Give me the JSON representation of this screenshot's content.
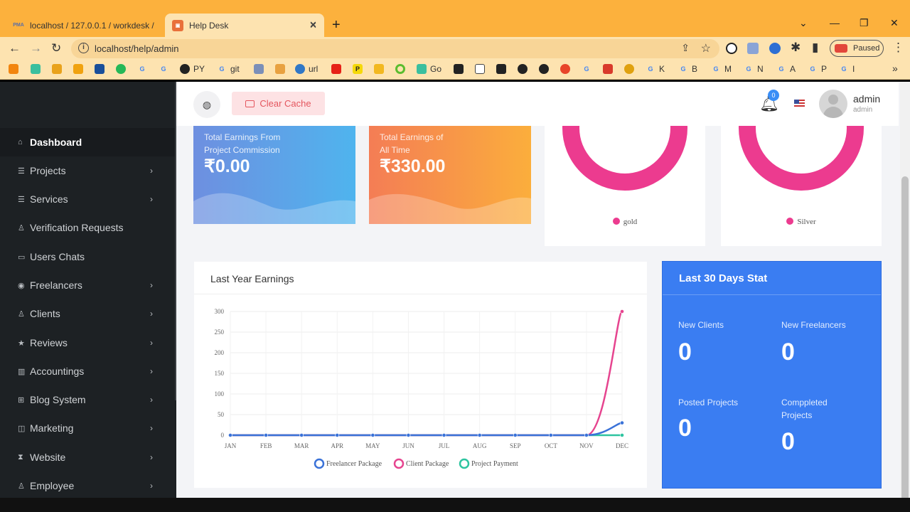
{
  "browser": {
    "tabs": [
      {
        "title": "localhost / 127.0.0.1 / workdesk /",
        "active": false
      },
      {
        "title": "Help Desk",
        "active": true
      }
    ],
    "url": "localhost/help/admin",
    "profile_status": "Paused",
    "bookmarks": [
      "PY",
      "git",
      "url",
      "Go",
      "K",
      "B",
      "M",
      "N",
      "A",
      "P",
      "I"
    ]
  },
  "header": {
    "clear_cache_label": "Clear Cache",
    "notification_count": "0",
    "user_name": "admin",
    "user_role": "admin"
  },
  "sidebar": {
    "items": [
      {
        "label": "Dashboard",
        "active": true
      },
      {
        "label": "Projects",
        "has_submenu": true
      },
      {
        "label": "Services",
        "has_submenu": true
      },
      {
        "label": "Verification Requests",
        "has_submenu": false
      },
      {
        "label": "Users Chats",
        "has_submenu": false
      },
      {
        "label": "Freelancers",
        "has_submenu": true
      },
      {
        "label": "Clients",
        "has_submenu": true
      },
      {
        "label": "Reviews",
        "has_submenu": true
      },
      {
        "label": "Accountings",
        "has_submenu": true
      },
      {
        "label": "Blog System",
        "has_submenu": true
      },
      {
        "label": "Marketing",
        "has_submenu": true
      },
      {
        "label": "Website",
        "has_submenu": true
      },
      {
        "label": "Employee",
        "has_submenu": true
      }
    ]
  },
  "stat_cards": [
    {
      "label_line1": "Total Earnings From",
      "label_line2": "Project Commission",
      "value": "₹0.00",
      "theme": "blue"
    },
    {
      "label_line1": "Total Earnings of",
      "label_line2": "All Time",
      "value": "₹330.00",
      "theme": "orange"
    }
  ],
  "donuts": [
    {
      "legend": "gold",
      "color": "#ec3b8f"
    },
    {
      "legend": "Silver",
      "color": "#ec3b8f"
    }
  ],
  "last30": {
    "title": "Last 30 Days Stat",
    "stats": [
      {
        "label_line1": "New Clients",
        "label_line2": "",
        "value": "0"
      },
      {
        "label_line1": "New Freelancers",
        "label_line2": "",
        "value": "0"
      },
      {
        "label_line1": "Posted Projects",
        "label_line2": "",
        "value": "0"
      },
      {
        "label_line1": "Comppleted",
        "label_line2": "Projects",
        "value": "0"
      }
    ]
  },
  "chart_data": {
    "type": "line",
    "title": "Last Year Earnings",
    "categories": [
      "JAN",
      "FEB",
      "MAR",
      "APR",
      "MAY",
      "JUN",
      "JUL",
      "AUG",
      "SEP",
      "OCT",
      "NOV",
      "DEC"
    ],
    "ylim": [
      0,
      300
    ],
    "yticks": [
      0,
      50,
      100,
      150,
      200,
      250,
      300
    ],
    "grid": true,
    "legend_position": "bottom",
    "series": [
      {
        "name": "Freelancer Package",
        "color": "#3a72d8",
        "values": [
          0,
          0,
          0,
          0,
          0,
          0,
          0,
          0,
          0,
          0,
          0,
          30
        ]
      },
      {
        "name": "Client Package",
        "color": "#e6448f",
        "values": [
          0,
          0,
          0,
          0,
          0,
          0,
          0,
          0,
          0,
          0,
          0,
          300
        ]
      },
      {
        "name": "Project Payment",
        "color": "#2ec4a0",
        "values": [
          0,
          0,
          0,
          0,
          0,
          0,
          0,
          0,
          0,
          0,
          0,
          0
        ]
      }
    ]
  }
}
